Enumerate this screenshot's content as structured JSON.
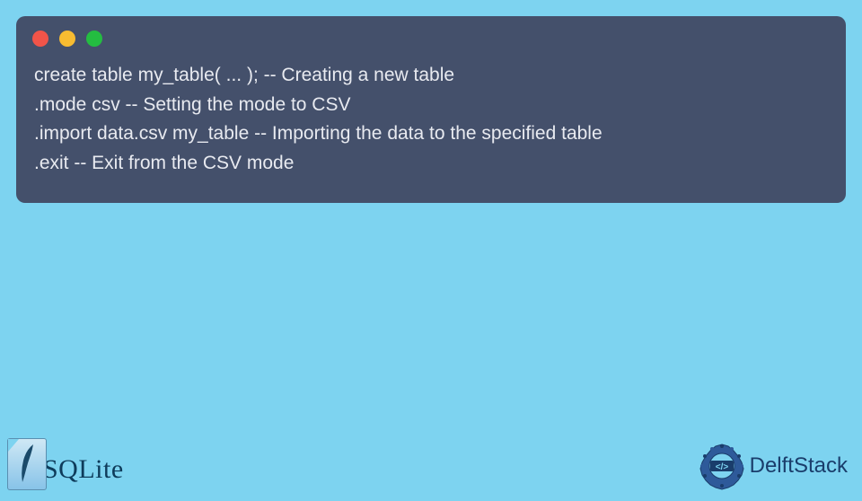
{
  "code": {
    "lines": [
      "create table my_table( ... ); -- Creating a new table",
      ".mode csv -- Setting the mode to CSV",
      ".import data.csv my_table -- Importing the data to the specified table",
      ".exit -- Exit from the CSV mode"
    ]
  },
  "logos": {
    "sqlite": "SQLite",
    "delftstack": "DelftStack",
    "delft_code": "</>"
  }
}
